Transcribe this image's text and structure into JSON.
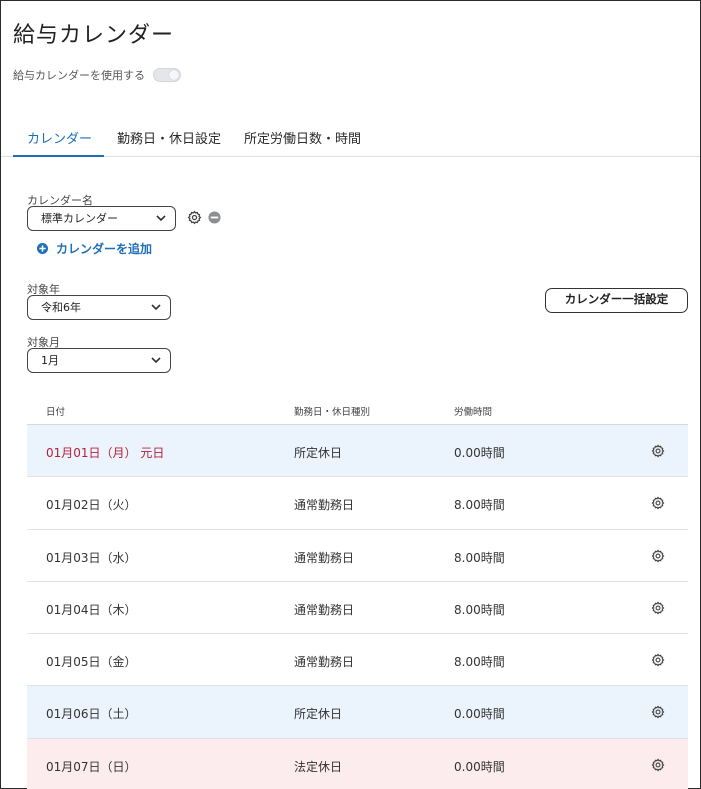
{
  "page": {
    "title": "給与カレンダー"
  },
  "toggle": {
    "label": "給与カレンダーを使用する",
    "enabled": false
  },
  "tabs": [
    {
      "label": "カレンダー",
      "active": true
    },
    {
      "label": "勤務日・休日設定",
      "active": false
    },
    {
      "label": "所定労働日数・時間",
      "active": false
    }
  ],
  "calendar_name": {
    "label": "カレンダー名",
    "value": "標準カレンダー",
    "add_label": "カレンダーを追加"
  },
  "target_year": {
    "label": "対象年",
    "value": "令和6年"
  },
  "target_month": {
    "label": "対象月",
    "value": "1月"
  },
  "bulk_button": {
    "label": "カレンダー一括設定"
  },
  "table": {
    "headers": [
      "日付",
      "勤務日・休日種別",
      "労働時間"
    ],
    "rows": [
      {
        "date": "01月01日（月） 元日",
        "type": "所定休日",
        "hours": "0.00時間",
        "style": "holiday-blue",
        "red": true
      },
      {
        "date": "01月02日（火）",
        "type": "通常勤務日",
        "hours": "8.00時間",
        "style": "",
        "red": false
      },
      {
        "date": "01月03日（水）",
        "type": "通常勤務日",
        "hours": "8.00時間",
        "style": "",
        "red": false
      },
      {
        "date": "01月04日（木）",
        "type": "通常勤務日",
        "hours": "8.00時間",
        "style": "",
        "red": false
      },
      {
        "date": "01月05日（金）",
        "type": "通常勤務日",
        "hours": "8.00時間",
        "style": "",
        "red": false
      },
      {
        "date": "01月06日（土）",
        "type": "所定休日",
        "hours": "0.00時間",
        "style": "holiday-blue",
        "red": false
      },
      {
        "date": "01月07日（日）",
        "type": "法定休日",
        "hours": "0.00時間",
        "style": "holiday-red",
        "red": false
      }
    ]
  },
  "colors": {
    "accent": "#1f6fb7",
    "holiday_blue_bg": "#ebf4fd",
    "holiday_red_bg": "#fdecee",
    "holiday_text": "#b3213a"
  }
}
